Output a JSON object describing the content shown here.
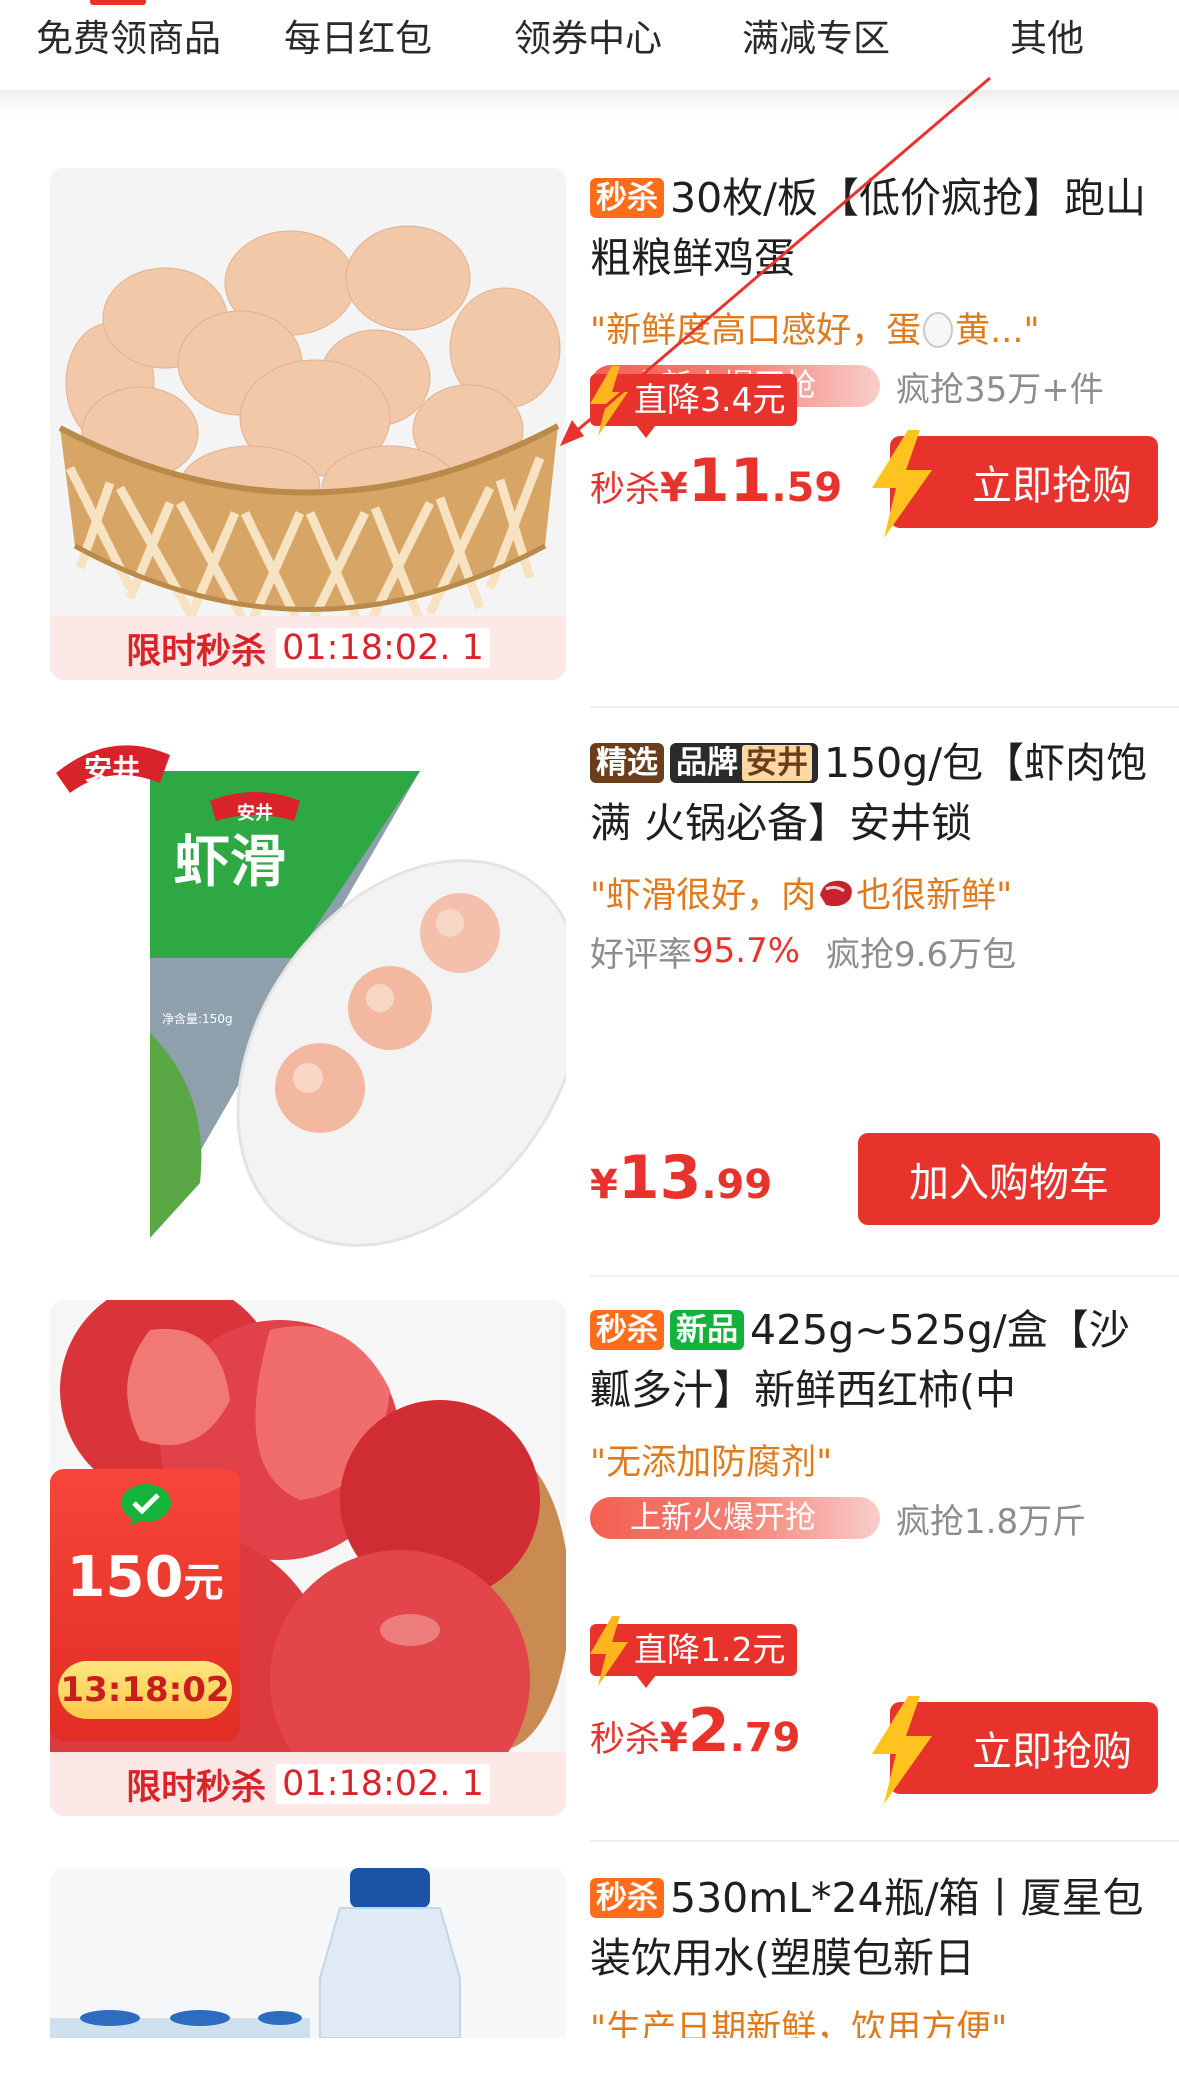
{
  "tabs": [
    "免费领商品",
    "每日红包",
    "领券中心",
    "满减专区",
    "其他"
  ],
  "products": [
    {
      "tags": [
        "秒杀"
      ],
      "title": "30枚/板【低价疯抢】跑山粗粮鲜鸡蛋",
      "quote_pre": "\"新鲜度高口感好，蛋",
      "quote_post": "黄...\"",
      "hot_label": "上新火爆开抢",
      "sold": "疯抢35万+件",
      "drop": "直降3.4元",
      "price_label": "秒杀",
      "currency": "¥",
      "price_int": "11",
      "price_dec": ".59",
      "button": "立即抢购",
      "sale_label": "限时秒杀",
      "countdown": "01:18:02. 1"
    },
    {
      "tag_selected": "精选",
      "tag_brand": "品牌",
      "tag_brand_name": "安井",
      "title": "150g/包【虾肉饱满 火锅必备】安井锁",
      "quote_pre": "\"虾滑很好，肉",
      "quote_post": "也很新鲜\"",
      "rating_label": "好评率",
      "rating": "95.7%",
      "sold": "疯抢9.6万包",
      "currency": "¥",
      "price_int": "13",
      "price_dec": ".99",
      "button": "加入购物车",
      "package": {
        "brand": "安井",
        "name": "虾滑",
        "net": "净含量:150g"
      }
    },
    {
      "tags": [
        "秒杀",
        "新品"
      ],
      "title": "425g~525g/盒【沙瓤多汁】新鲜西红柿(中",
      "quote": "\"无添加防腐剂\"",
      "hot_label": "上新火爆开抢",
      "sold": "疯抢1.8万斤",
      "drop": "直降1.2元",
      "price_label": "秒杀",
      "currency": "¥",
      "price_int": "2",
      "price_dec": ".79",
      "button": "立即抢购",
      "sale_label": "限时秒杀",
      "countdown": "01:18:02. 1",
      "envelope": {
        "amount": "150",
        "unit": "元",
        "timer": "13:18:02"
      }
    },
    {
      "tags": [
        "秒杀"
      ],
      "title": "530mL*24瓶/箱丨厦星包装饮用水(塑膜包新日",
      "quote": "\"生产日期新鲜，饮用方便\""
    }
  ],
  "colors": {
    "accent": "#e8332d",
    "seckill_tag": "#ff6d1a",
    "new_tag": "#12b33c",
    "quote": "#e07a1d",
    "annotation_arrow": "#e8332d"
  }
}
